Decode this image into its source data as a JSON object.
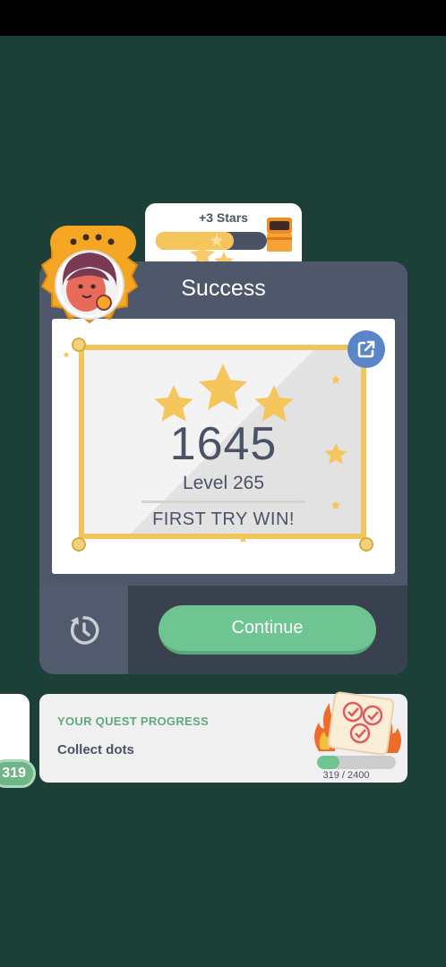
{
  "reward": {
    "stars_label": "+3 Stars",
    "stars_progress": 0.7
  },
  "result": {
    "title": "Success",
    "score": "1645",
    "level": "Level 265",
    "message": "FIRST TRY WIN!",
    "stars_earned": 3
  },
  "actions": {
    "continue_label": "Continue"
  },
  "quest": {
    "title": "YOUR QUEST PROGRESS",
    "description": "Collect dots",
    "progress_text": "319 / 2400",
    "progress": 0.133,
    "side_badge": "319"
  },
  "colors": {
    "background": "#1c3f38",
    "card": "#4f586b",
    "gold": "#f0c65b",
    "continue": "#6fc592",
    "share": "#5b84c9"
  },
  "icons": [
    "share-icon",
    "replay-icon",
    "treasure-chest-icon",
    "avatar-icon",
    "quest-scroll-icon",
    "fire-icon"
  ]
}
